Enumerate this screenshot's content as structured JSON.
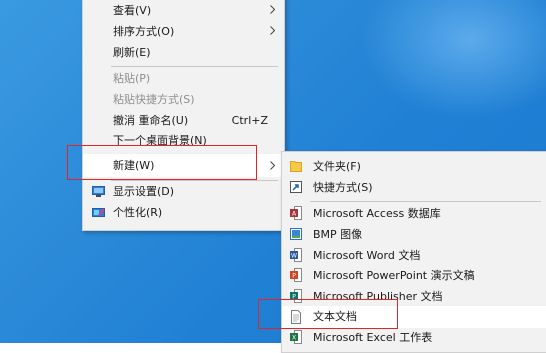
{
  "context_menu": {
    "items": [
      {
        "label": "查看(V)",
        "has_submenu": true
      },
      {
        "label": "排序方式(O)",
        "has_submenu": true
      },
      {
        "label": "刷新(E)"
      },
      {
        "label": "粘贴(P)",
        "disabled": true
      },
      {
        "label": "粘贴快捷方式(S)",
        "disabled": true
      },
      {
        "label": "撤消 重命名(U)",
        "shortcut": "Ctrl+Z"
      },
      {
        "label": "下一个桌面背景(N)"
      },
      {
        "label": "新建(W)",
        "has_submenu": true,
        "highlighted": true
      },
      {
        "label": "显示设置(D)",
        "icon": "display-icon"
      },
      {
        "label": "个性化(R)",
        "icon": "personalize-icon"
      }
    ]
  },
  "new_submenu": {
    "items": [
      {
        "label": "文件夹(F)",
        "icon": "folder-icon"
      },
      {
        "label": "快捷方式(S)",
        "icon": "shortcut-icon"
      },
      {
        "label": "Microsoft Access 数据库",
        "icon": "access-icon"
      },
      {
        "label": "BMP 图像",
        "icon": "bmp-icon"
      },
      {
        "label": "Microsoft Word 文档",
        "icon": "word-icon"
      },
      {
        "label": "Microsoft PowerPoint 演示文稿",
        "icon": "powerpoint-icon"
      },
      {
        "label": "Microsoft Publisher 文档",
        "icon": "publisher-icon"
      },
      {
        "label": "文本文档",
        "icon": "text-document-icon",
        "highlighted": true
      },
      {
        "label": "Microsoft Excel 工作表",
        "icon": "excel-icon"
      }
    ]
  },
  "colors": {
    "desktop": "#2a88d6",
    "menu_bg": "#f2f2f2",
    "highlight_box": "#e0262b",
    "access": "#a4373a",
    "word": "#2b579a",
    "powerpoint": "#d24726",
    "publisher": "#077568",
    "excel": "#217346"
  }
}
